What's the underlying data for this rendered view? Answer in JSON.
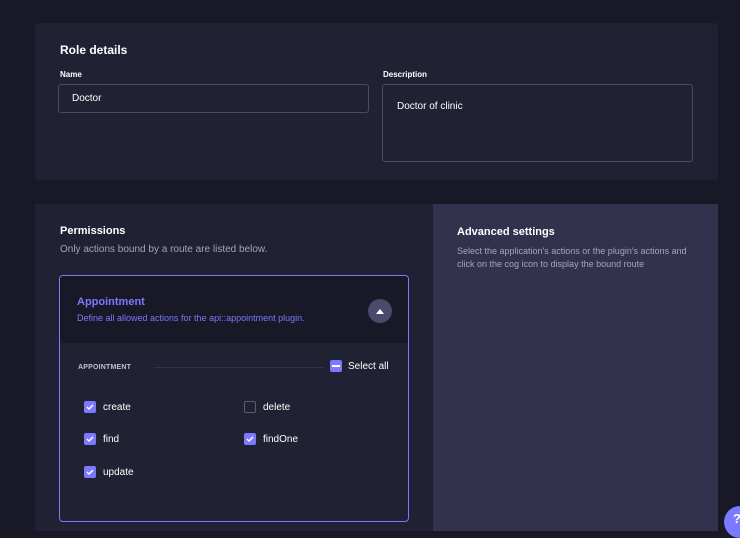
{
  "role_details": {
    "title": "Role details",
    "name_label": "Name",
    "name_value": "Doctor",
    "description_label": "Description",
    "description_value": "Doctor of clinic"
  },
  "permissions": {
    "title": "Permissions",
    "subtitle": "Only actions bound by a route are listed below.",
    "accordion": {
      "title": "Appointment",
      "description": "Define all allowed actions for the api::appointment plugin.",
      "expanded": true,
      "section_label": "APPOINTMENT",
      "select_all_label": "Select all",
      "select_all_state": "indeterminate",
      "actions": [
        {
          "label": "create",
          "checked": true
        },
        {
          "label": "delete",
          "checked": false
        },
        {
          "label": "find",
          "checked": true
        },
        {
          "label": "findOne",
          "checked": true
        },
        {
          "label": "update",
          "checked": true
        }
      ]
    }
  },
  "advanced_settings": {
    "title": "Advanced settings",
    "text": "Select the application's actions or the plugin's actions and click on the cog icon to display the bound route"
  },
  "help_button": {
    "label": "?"
  },
  "colors": {
    "background": "#181826",
    "card": "#212134",
    "panel": "#32324d",
    "accent": "#7b79ff",
    "muted_text": "#a5a5ba"
  }
}
